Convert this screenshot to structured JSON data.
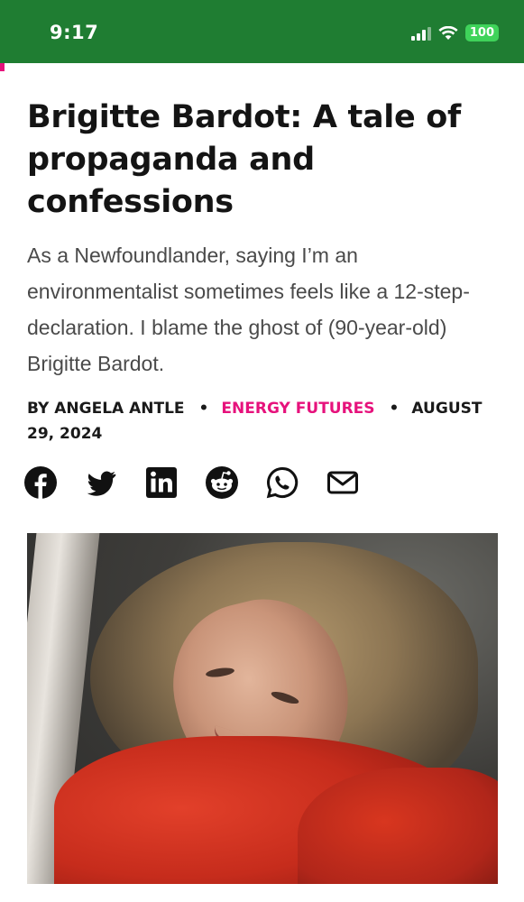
{
  "status_bar": {
    "time": "9:17",
    "battery": "100",
    "background_color": "#1f7d32",
    "icons": [
      "cellular-signal-icon",
      "wifi-icon",
      "battery-icon"
    ]
  },
  "article": {
    "headline": "Brigitte Bardot: A tale of propaganda and confessions",
    "dek": "As a Newfoundlander, saying I’m an environmentalist sometimes feels like a 12-step-declaration. I blame the ghost of (90-year-old) Brigitte Bardot.",
    "byline": {
      "author": "BY ANGELA ANTLE",
      "separator": "•",
      "category": "ENERGY FUTURES",
      "date": "AUGUST 29, 2024"
    },
    "accent_color": "#e6127c"
  },
  "share": {
    "icons": [
      "facebook-icon",
      "twitter-icon",
      "linkedin-icon",
      "reddit-icon",
      "whatsapp-icon",
      "email-icon"
    ]
  },
  "hero_image": {
    "subject": "photo"
  }
}
